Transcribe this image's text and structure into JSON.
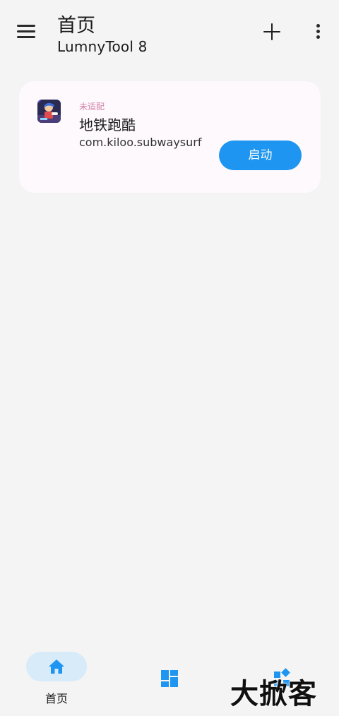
{
  "header": {
    "title": "首页",
    "subtitle": "LumnyTool 8",
    "icons": {
      "menu": "menu-icon",
      "add": "add-icon",
      "more": "more-vert-icon"
    }
  },
  "card": {
    "status": "未适配",
    "app_name": "地铁跑酷",
    "package": "com.kiloo.subwaysurf",
    "launch_label": "启动",
    "colors": {
      "status": "#d47fa9",
      "launch": "#1e95f0",
      "card_bg": "#fdf9fd"
    }
  },
  "bottom_nav": {
    "items": [
      {
        "label": "首页",
        "icon": "home-icon",
        "active": true
      },
      {
        "label": "",
        "icon": "dashboard-icon",
        "active": false
      },
      {
        "label": "",
        "icon": "widgets-icon",
        "active": false
      }
    ],
    "accent": "#1e95f0"
  },
  "watermark": "大掀客"
}
